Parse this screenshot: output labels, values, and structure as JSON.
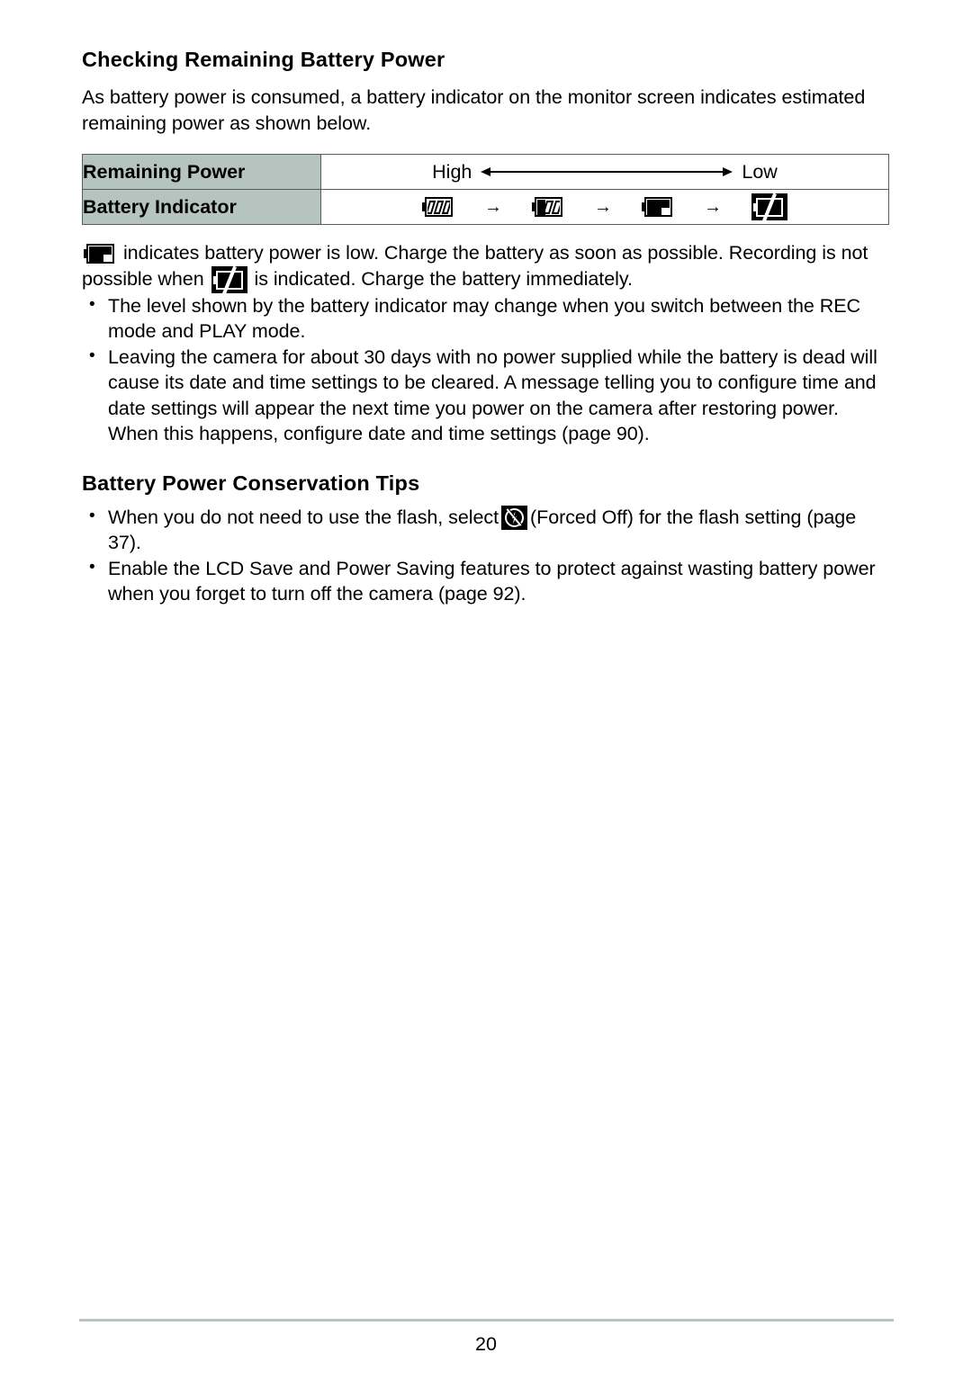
{
  "document": {
    "page_number": "20"
  },
  "sections": {
    "checking_power": {
      "heading": "Checking Remaining Battery Power",
      "intro_line1": "As battery power is consumed, a battery indicator on the monitor screen indicates",
      "intro_line2": "estimated remaining power as shown below."
    },
    "conservation": {
      "heading": "Battery Power Conservation Tips"
    }
  },
  "table": {
    "rows": [
      {
        "label": "Remaining Power"
      },
      {
        "label": "Battery Indicator"
      }
    ],
    "range": {
      "high_label": "High",
      "low_label": "Low",
      "arrow_icon": "double-headed-arrow-icon"
    },
    "indicators": [
      {
        "name": "battery-full-icon",
        "level": "full"
      },
      {
        "name": "battery-two-thirds-icon",
        "level": "two-thirds"
      },
      {
        "name": "battery-low-icon",
        "level": "low"
      },
      {
        "name": "battery-empty-icon",
        "level": "empty"
      }
    ],
    "step_arrow": "→"
  },
  "notes": {
    "low_note_line1": "indicates battery power is low. Charge the battery as soon as possible.",
    "low_note_line2_a": "Recording is not possible when",
    "low_note_line2_b": "is indicated. Charge the battery immediately.",
    "bullet": "•",
    "items": [
      "The level shown by the battery indicator may change when you switch between the REC mode and PLAY mode.",
      "Leaving the camera for about 30 days with no power supplied while the battery is dead will cause its date and time settings to be cleared. A message telling you to configure time and date settings will appear the next time you power on the camera after restoring power. When this happens, configure date and time settings (page 90)."
    ]
  },
  "tips": {
    "bullet": "•",
    "item1_a": "When you do not need to use the flash, select",
    "item1_b": "(Forced Off) for the flash setting (page 37).",
    "item2": "Enable the LCD Save and Power Saving features to protect against wasting battery power when you forget to turn off the camera (page 92)."
  },
  "icons": {
    "flash_off": "flash-forced-off-icon"
  }
}
